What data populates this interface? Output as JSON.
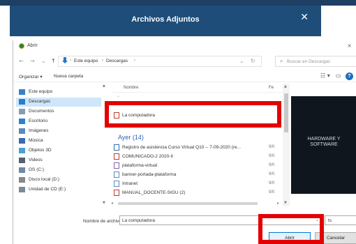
{
  "modal": {
    "title": "Archivos Adjuntos",
    "close_glyph": "✕"
  },
  "dialog": {
    "title": "Abrir",
    "close_glyph": "×",
    "nav": {
      "back": "←",
      "forward": "→",
      "up": "↑",
      "dropdown": "⌄",
      "refresh": "↻"
    },
    "breadcrumb": [
      "Este equipo",
      "Descargas"
    ],
    "breadcrumb_sep": "›",
    "search_placeholder": "Buscar en Descargas",
    "toolbar": {
      "organize": "Organizar ▾",
      "new_folder": "Nueva carpeta",
      "view_glyph": "☷ ▾",
      "pane_glyph": "▭",
      "help": "?"
    },
    "sidebar": {
      "items": [
        {
          "label": "Este equipo",
          "icon": "computer-icon",
          "color": "#3c7fc6"
        },
        {
          "label": "Descargas",
          "icon": "downloads-icon",
          "color": "#2a7bd0"
        },
        {
          "label": "Documentos",
          "icon": "documents-icon",
          "color": "#8a9bb0"
        },
        {
          "label": "Escritorio",
          "icon": "desktop-icon",
          "color": "#2f7fd0"
        },
        {
          "label": "Imágenes",
          "icon": "pictures-icon",
          "color": "#5a8ac0"
        },
        {
          "label": "Música",
          "icon": "music-icon",
          "color": "#3a6ab0"
        },
        {
          "label": "Objetos 3D",
          "icon": "objects3d-icon",
          "color": "#4aa0d8"
        },
        {
          "label": "Videos",
          "icon": "videos-icon",
          "color": "#556070"
        },
        {
          "label": "OS (C:)",
          "icon": "drive-icon",
          "color": "#6a8aa8"
        },
        {
          "label": "Disco local (D:)",
          "icon": "drive-icon",
          "color": "#888888"
        },
        {
          "label": "Unidad de CD (E:)",
          "icon": "cd-drive-icon",
          "color": "#7a8a9a"
        }
      ]
    },
    "columns": {
      "name": "Nombre",
      "fe": "Fe"
    },
    "file_top": {
      "name": "La computadora"
    },
    "group": {
      "label": "Ayer (14)"
    },
    "files": [
      {
        "name": "Registro de asistencia Curso Virtual Q10 -- 7-09-2020 (re...",
        "date": "9/0",
        "icon_color": "#2e6ab0"
      },
      {
        "name": "COMUNICADO-2 2020-II",
        "date": "9/0",
        "icon_color": "#c23b2a"
      },
      {
        "name": "plataforma-virtual",
        "date": "9/0",
        "icon_color": "#8a5ab0"
      },
      {
        "name": "banner-portada-plataforma",
        "date": "9/0",
        "icon_color": "#5a8ac0"
      },
      {
        "name": "Intranet",
        "date": "9/0",
        "icon_color": "#5a8ac0"
      },
      {
        "name": "MANUAL_DOCENTE-SIGU (2)",
        "date": "9/0",
        "icon_color": "#c23b2a"
      }
    ],
    "preview": {
      "line1": "HARDWARE Y",
      "line2": "SOFTWARE"
    },
    "filename_label": "Nombre de archivo:",
    "filename_value": "La computadora",
    "filter_value": "ts",
    "open_label": "Abrir",
    "cancel_label": "Cancelar"
  },
  "colors": {
    "modal_header": "#1e4d79",
    "highlight": "#e40000",
    "selection": "#cfe6fa",
    "accent": "#0078d7"
  }
}
